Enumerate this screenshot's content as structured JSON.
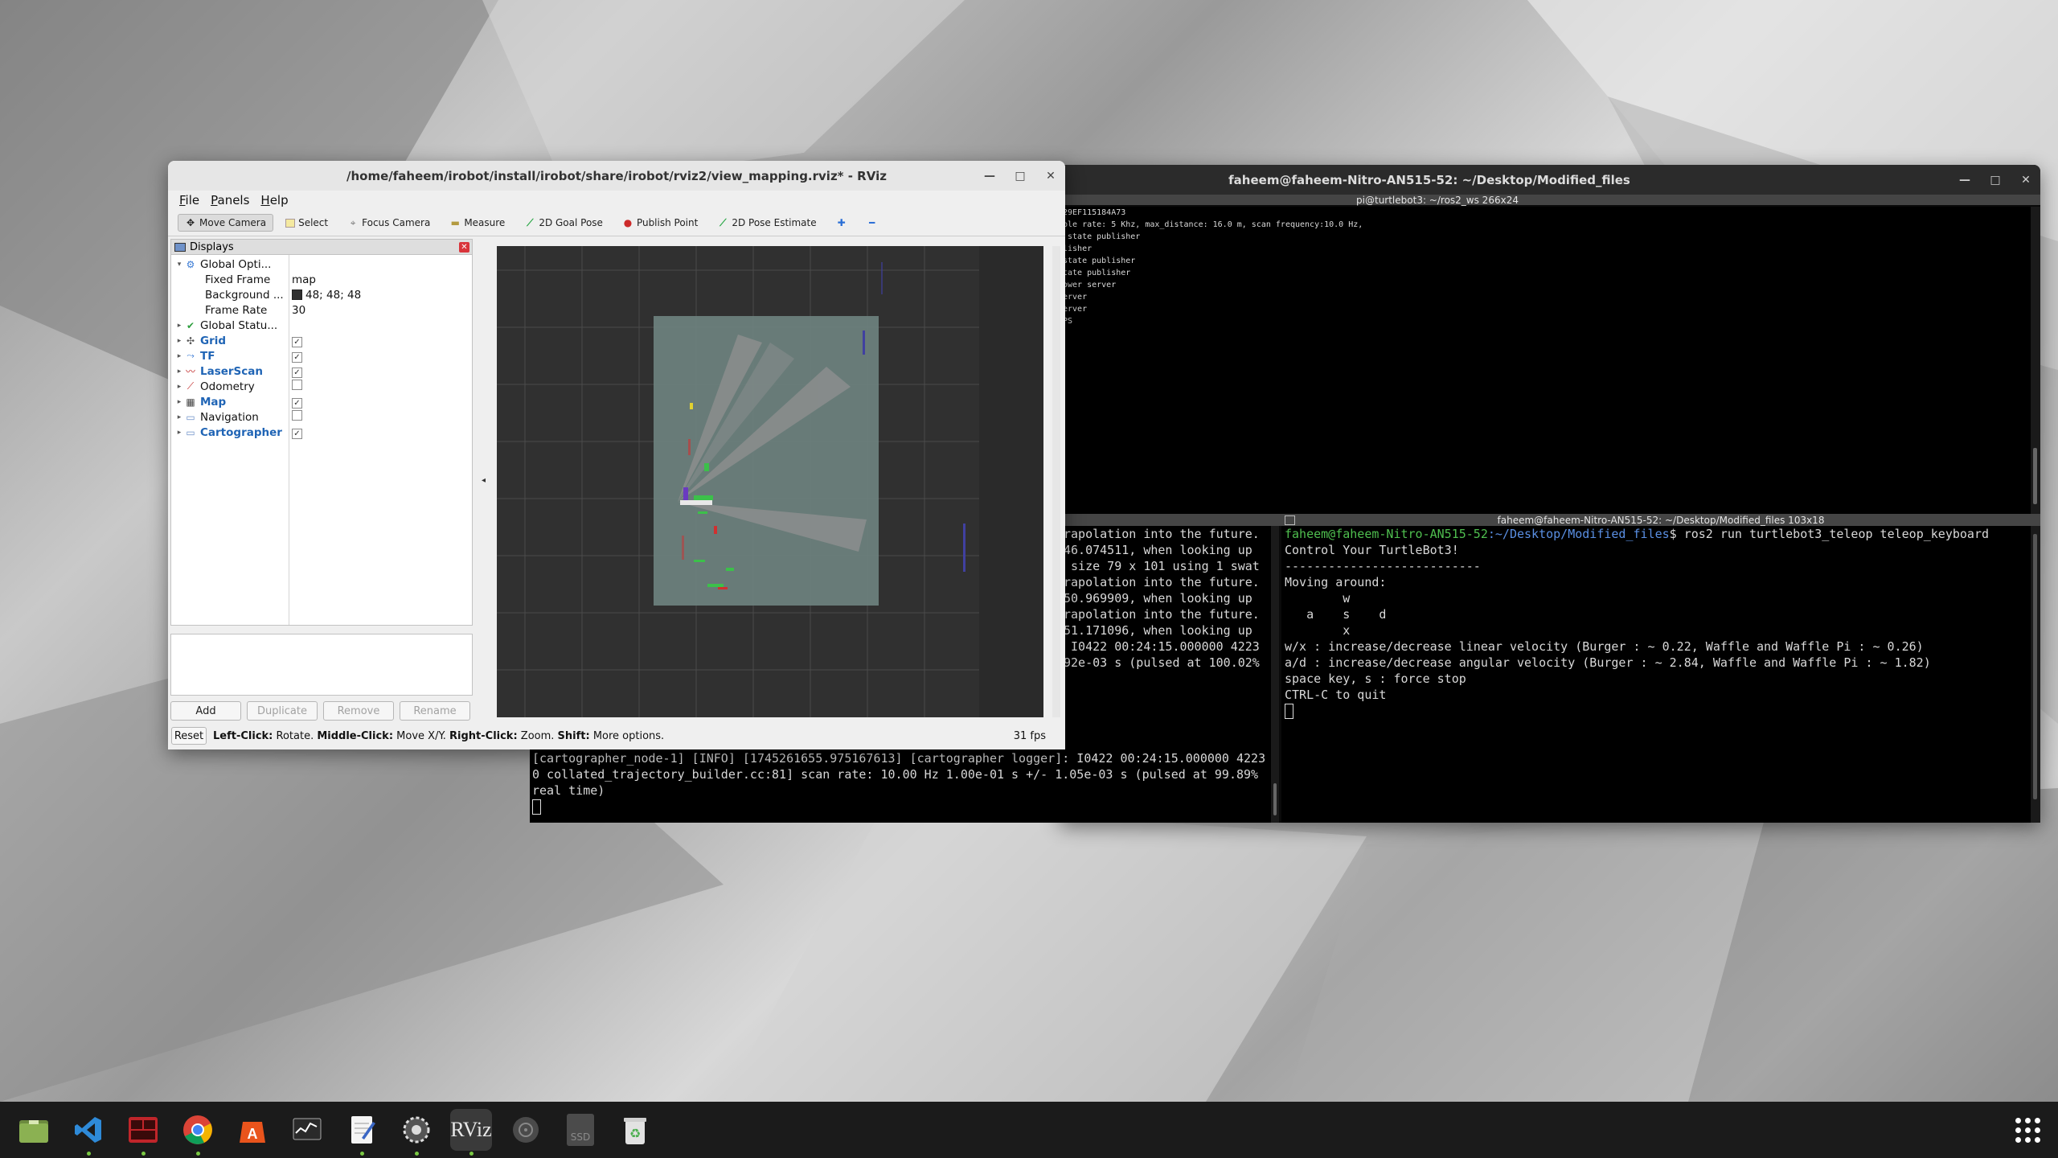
{
  "rviz": {
    "title": "/home/faheem/irobot/install/irobot/share/irobot/rviz2/view_mapping.rviz* - RViz",
    "menu": [
      "File",
      "Panels",
      "Help"
    ],
    "toolbar": [
      "Move Camera",
      "Select",
      "Focus Camera",
      "Measure",
      "2D Goal Pose",
      "Publish Point",
      "2D Pose Estimate"
    ],
    "displays_header": "Displays",
    "tree": [
      {
        "label": "Global Opti...",
        "blue": false,
        "expanded": true,
        "icon": "gear-icon"
      },
      {
        "label": "Fixed Frame",
        "value": "map",
        "child": true
      },
      {
        "label": "Background ...",
        "value": "48; 48; 48",
        "child": true,
        "swatch": "#303030"
      },
      {
        "label": "Frame Rate",
        "value": "30",
        "child": true
      },
      {
        "label": "Global Statu...",
        "blue": false,
        "icon": "check-icon"
      },
      {
        "label": "Grid",
        "blue": true,
        "checked": true,
        "icon": "grid-icon"
      },
      {
        "label": "TF",
        "blue": true,
        "checked": true,
        "icon": "tf-icon"
      },
      {
        "label": "LaserScan",
        "blue": true,
        "checked": true,
        "icon": "laserscan-icon"
      },
      {
        "label": "Odometry",
        "blue": false,
        "checked": false,
        "icon": "odometry-icon"
      },
      {
        "label": "Map",
        "blue": true,
        "checked": true,
        "icon": "map-icon"
      },
      {
        "label": "Navigation",
        "blue": false,
        "checked": false,
        "icon": "folder-icon"
      },
      {
        "label": "Cartographer",
        "blue": true,
        "checked": true,
        "icon": "folder-icon"
      }
    ],
    "buttons": {
      "add": "Add",
      "duplicate": "Duplicate",
      "remove": "Remove",
      "rename": "Rename"
    },
    "status": {
      "reset": "Reset",
      "l1": "Left-Click:",
      "l1t": " Rotate. ",
      "l2": "Middle-Click:",
      "l2t": " Move X/Y. ",
      "l3": "Right-Click:",
      "l3t": " Zoom. ",
      "l4": "Shift:",
      "l4t": " More options.",
      "fps": "31 fps"
    },
    "background_color": "#303030"
  },
  "terminal": {
    "title": "faheem@faheem-Nitro-AN515-52: ~/Desktop/Modified_files",
    "top_sub": "pi@turtlebot3: ~/ros2_ws 266x24",
    "top_lines": [
      "29EF115184A73",
      "",
      "",
      "",
      "",
      "",
      "ple rate: 5 Khz, max_distance: 16.0 m, scan frequency:10.0 Hz,",
      "",
      "",
      "",
      "",
      "",
      " state publisher",
      "lisher",
      "state publisher",
      "tate publisher",
      "",
      "ower server",
      "erver",
      "erver",
      "",
      "",
      "PS"
    ],
    "right_sub": "faheem@faheem-Nitro-AN515-52: ~/Desktop/Modified_files 103x18",
    "left_lines": [
      "rapolation into the future.",
      "46.074511, when looking up",
      "",
      " size 79 x 101 using 1 swat",
      "",
      "",
      "rapolation into the future.",
      "50.969909, when looking up",
      "",
      "rapolation into the future.",
      "51.171096, when looking up",
      "",
      " I0422 00:24:15.000000 4223",
      "92e-03 s (pulsed at 100.02%"
    ],
    "prompt_user": "faheem@faheem-Nitro-AN515-52",
    "prompt_path": ":~/Desktop/Modified_files",
    "command": "$ ros2 run turtlebot3_teleop teleop_keyboard",
    "right_lines": [
      "",
      "Control Your TurtleBot3!",
      "---------------------------",
      "Moving around:",
      "        w",
      "   a    s    d",
      "        x",
      "",
      "w/x : increase/decrease linear velocity (Burger : ~ 0.22, Waffle and Waffle Pi : ~ 0.26)",
      "a/d : increase/decrease angular velocity (Burger : ~ 2.84, Waffle and Waffle Pi : ~ 1.82)",
      "",
      "space key, s : force stop",
      "",
      "CTRL-C to quit",
      ""
    ],
    "log_lines": [
      "[cartographer_node-1] [INFO] [1745261655.975167613] [cartographer logger]: I0422 00:24:15.000000 4223",
      "0 collated_trajectory_builder.cc:81] scan rate: 10.00 Hz 1.00e-01 s +/- 1.05e-03 s (pulsed at 99.89%",
      "real time)"
    ]
  },
  "taskbar": {
    "apps": [
      {
        "name": "files-icon",
        "active": false,
        "running": false
      },
      {
        "name": "vscode-icon",
        "active": false,
        "running": true
      },
      {
        "name": "terminator-icon",
        "active": false,
        "running": true
      },
      {
        "name": "chrome-icon",
        "active": false,
        "running": true
      },
      {
        "name": "app-center-icon",
        "active": false,
        "running": false
      },
      {
        "name": "system-monitor-icon",
        "active": false,
        "running": false
      },
      {
        "name": "text-editor-icon",
        "active": false,
        "running": true
      },
      {
        "name": "settings-icon",
        "active": false,
        "running": true
      },
      {
        "name": "rviz-icon",
        "active": true,
        "running": true
      },
      {
        "name": "disk-icon",
        "active": false,
        "running": false
      },
      {
        "name": "ssd-icon",
        "active": false,
        "running": false
      },
      {
        "name": "trash-icon",
        "active": false,
        "running": false
      }
    ],
    "rviz_label": "RViz",
    "ssd_label": "SSD"
  }
}
